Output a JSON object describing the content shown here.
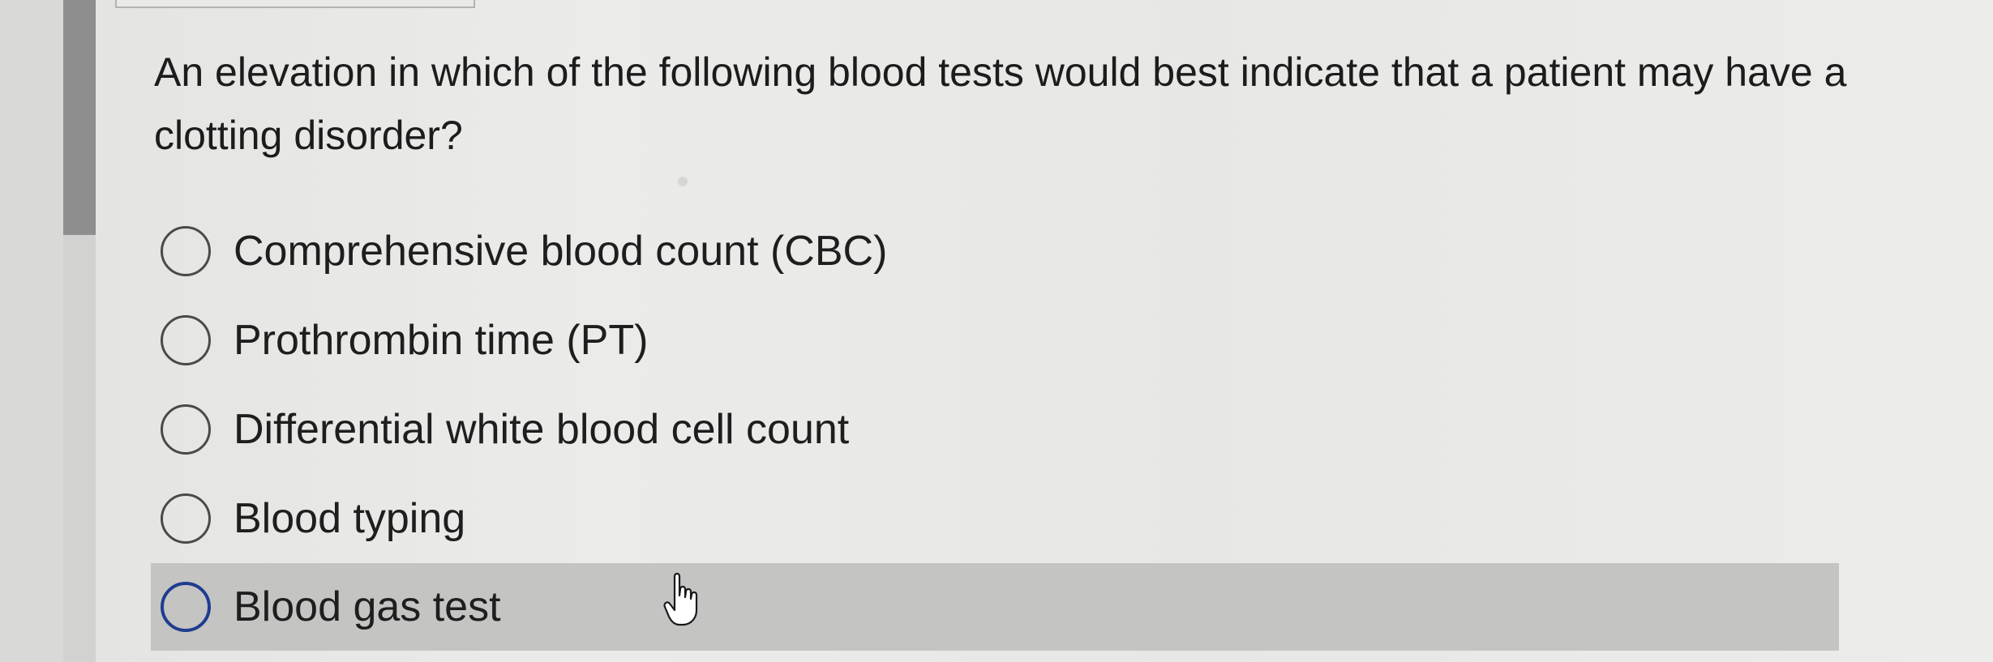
{
  "question": {
    "text": "An elevation in which of the following blood tests would best indicate that a patient may have a clotting disorder?"
  },
  "options": [
    {
      "label": "Comprehensive blood count (CBC)",
      "selected": false
    },
    {
      "label": "Prothrombin time (PT)",
      "selected": false
    },
    {
      "label": "Differential white blood cell count",
      "selected": false
    },
    {
      "label": "Blood typing",
      "selected": false
    },
    {
      "label": "Blood gas test",
      "selected": false,
      "hovered": true
    }
  ],
  "colors": {
    "hover_row": "#c4c4c3",
    "focus_radio": "#1f3d8f",
    "scroll_thumb": "#8e8e8e"
  },
  "icons": {
    "cursor": "hand-pointer-icon"
  }
}
